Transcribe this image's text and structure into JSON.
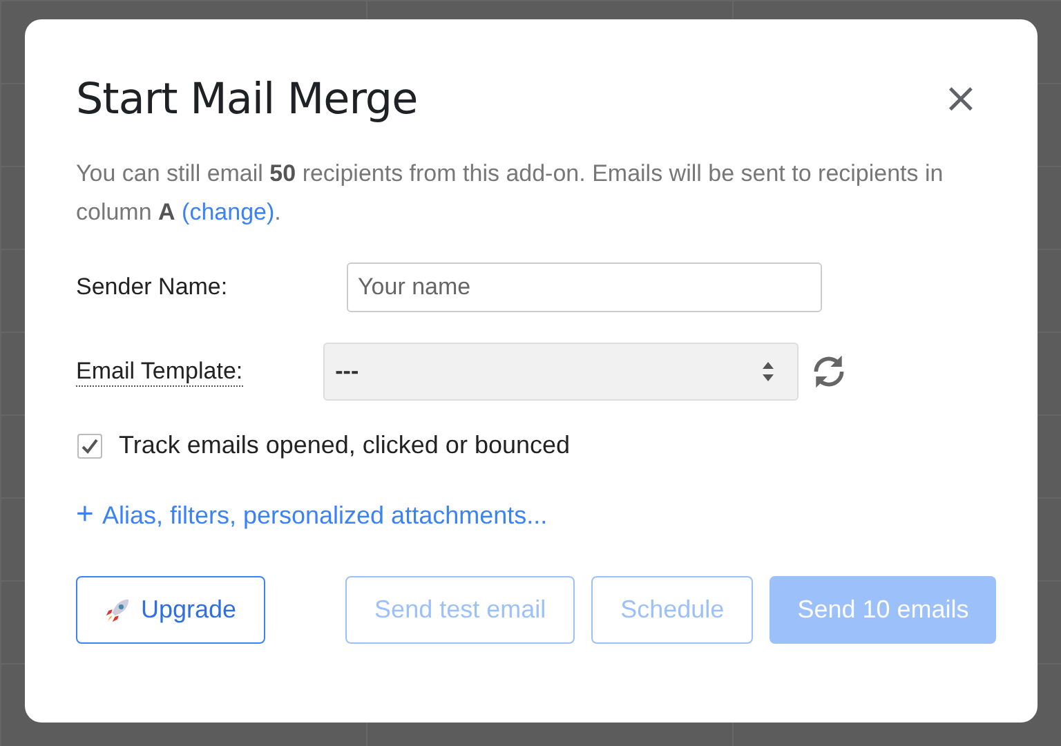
{
  "dialog": {
    "title": "Start Mail Merge",
    "close": "×"
  },
  "intro": "You can still email **50** recipients from this add-on. Emails will be sent to recipients in column **A**",
  "intro_link": "(change)",
  "intro_end": ".",
  "sender": {
    "label": "Sender Name:",
    "placeholder": "Your name"
  },
  "template": {
    "label": "Email Template:",
    "value": "---"
  },
  "tracking": {
    "label": "Track emails opened, clicked or bounced",
    "checked": true
  },
  "more_link": {
    "icon": "+",
    "label": "Alias, filters, personalized attachments..."
  },
  "buttons": [
    {
      "label": "Upgrade",
      "kind": "upgrade",
      "disabled": false
    },
    {
      "label": "Send test email",
      "kind": "outline",
      "disabled": true
    },
    {
      "label": "Schedule",
      "kind": "outline",
      "disabled": true
    },
    {
      "label": "Send 10 emails",
      "kind": "primary",
      "disabled": true
    }
  ]
}
